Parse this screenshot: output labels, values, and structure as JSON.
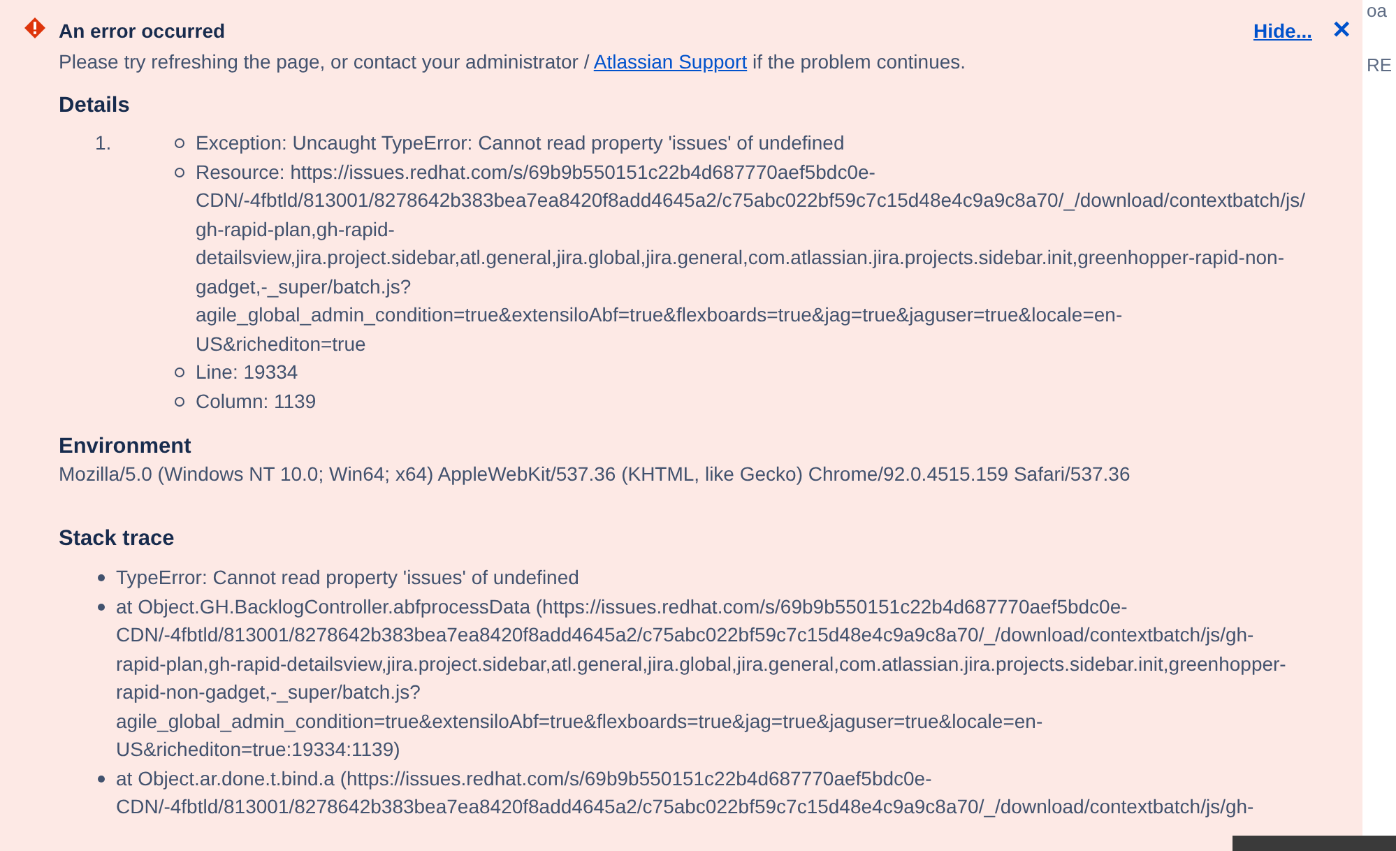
{
  "error_banner": {
    "title": "An error occurred",
    "message_before": "Please try refreshing the page, or contact your administrator / ",
    "message_link": "Atlassian Support",
    "message_after": " if the problem continues.",
    "hide_link": "Hide...",
    "close": "✕"
  },
  "details": {
    "heading": "Details",
    "number": "1.",
    "items": [
      {
        "text": "Exception: Uncaught TypeError: Cannot read property 'issues' of undefined"
      },
      {
        "text": "Resource: https://issues.redhat.com/s/69b9b550151c22b4d687770aef5bdc0e-\nCDN/-4fbtld/813001/8278642b383bea7ea8420f8add4645a2/c75abc022bf59c7c15d48e4c9a9c8a70/_/download/contextbatch/js/\ngh-rapid-plan,gh-rapid-\ndetailsview,jira.project.sidebar,atl.general,jira.global,jira.general,com.atlassian.jira.projects.sidebar.init,greenhopper-rapid-non-\ngadget,-_super/batch.js?\nagile_global_admin_condition=true&extensiloAbf=true&flexboards=true&jag=true&jaguser=true&locale=en-\nUS&richediton=true"
      },
      {
        "text": "Line: 19334"
      },
      {
        "text": "Column: 1139"
      }
    ]
  },
  "environment": {
    "heading": "Environment",
    "text": "Mozilla/5.0 (Windows NT 10.0; Win64; x64) AppleWebKit/537.36 (KHTML, like Gecko) Chrome/92.0.4515.159 Safari/537.36"
  },
  "stack_trace": {
    "heading": "Stack trace",
    "items": [
      {
        "text": "TypeError: Cannot read property 'issues' of undefined"
      },
      {
        "text": "at Object.GH.BacklogController.abfprocessData (https://issues.redhat.com/s/69b9b550151c22b4d687770aef5bdc0e-\nCDN/-4fbtld/813001/8278642b383bea7ea8420f8add4645a2/c75abc022bf59c7c15d48e4c9a9c8a70/_/download/contextbatch/js/gh-\nrapid-plan,gh-rapid-detailsview,jira.project.sidebar,atl.general,jira.global,jira.general,com.atlassian.jira.projects.sidebar.init,greenhopper-\nrapid-non-gadget,-_super/batch.js?\nagile_global_admin_condition=true&extensiloAbf=true&flexboards=true&jag=true&jaguser=true&locale=en-\nUS&richediton=true:19334:1139)"
      },
      {
        "text": "at Object.ar.done.t.bind.a (https://issues.redhat.com/s/69b9b550151c22b4d687770aef5bdc0e-\nCDN/-4fbtld/813001/8278642b383bea7ea8420f8add4645a2/c75abc022bf59c7c15d48e4c9a9c8a70/_/download/contextbatch/js/gh-"
      }
    ]
  },
  "background_page": {
    "fragments": [
      "oa",
      "RE"
    ]
  }
}
